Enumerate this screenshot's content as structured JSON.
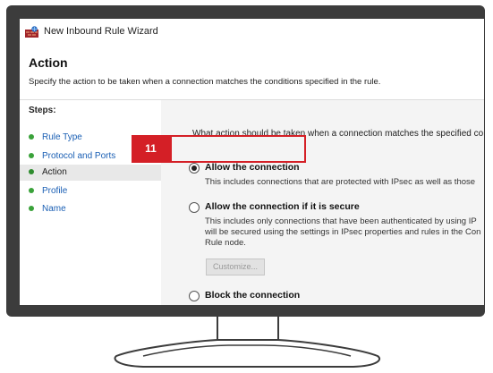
{
  "window": {
    "title": "New Inbound Rule Wizard",
    "icon": "firewall-wizard-icon"
  },
  "header": {
    "title": "Action",
    "description": "Specify the action to be taken when a connection matches the conditions specified in the rule."
  },
  "steps": {
    "heading": "Steps:",
    "items": [
      {
        "label": "Rule Type",
        "current": false
      },
      {
        "label": "Protocol and Ports",
        "current": false
      },
      {
        "label": "Action",
        "current": true
      },
      {
        "label": "Profile",
        "current": false
      },
      {
        "label": "Name",
        "current": false
      }
    ]
  },
  "main": {
    "question": "What action should be taken when a connection matches the specified co",
    "options": [
      {
        "label": "Allow the connection",
        "selected": true,
        "desc": [
          "This includes connections that are protected with IPsec as well as those"
        ]
      },
      {
        "label": "Allow the connection if it is secure",
        "selected": false,
        "desc": [
          "This includes only connections that have been authenticated by using IP",
          "will be secured using the settings in IPsec properties and rules in the Con",
          "Rule node."
        ]
      },
      {
        "label": "Block the connection",
        "selected": false,
        "desc": []
      }
    ],
    "customize_label": "Customize..."
  },
  "callout": {
    "number": "11",
    "color": "#d41f26"
  },
  "colors": {
    "frame": "#3c3c3c",
    "step_link": "#1a5fb4",
    "step_bullet": "#3aa23a",
    "content_bg": "#f4f4f4"
  }
}
